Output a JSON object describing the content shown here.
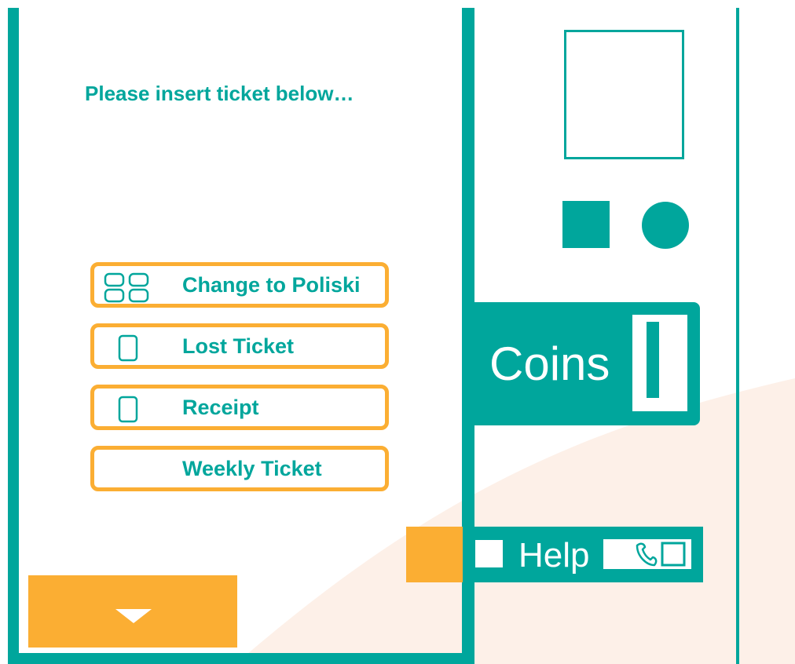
{
  "screen": {
    "prompt": "Please insert ticket below…"
  },
  "menu": {
    "items": [
      {
        "label": "Change to Poliski",
        "icon": "grid-icon"
      },
      {
        "label": "Lost Ticket",
        "icon": "ticket-icon"
      },
      {
        "label": "Receipt",
        "icon": "ticket-icon"
      },
      {
        "label": "Weekly Ticket",
        "icon": ""
      }
    ]
  },
  "scroll": {
    "icon": "arrow-down-icon"
  },
  "payment": {
    "coins_label": "Coins",
    "coin_slot_icon": "coin-slot-icon"
  },
  "help": {
    "label": "Help",
    "icon": "phone-icon"
  },
  "colors": {
    "teal": "#00a69c",
    "orange": "#fbae33",
    "background_accent": "#fdf0e8"
  }
}
